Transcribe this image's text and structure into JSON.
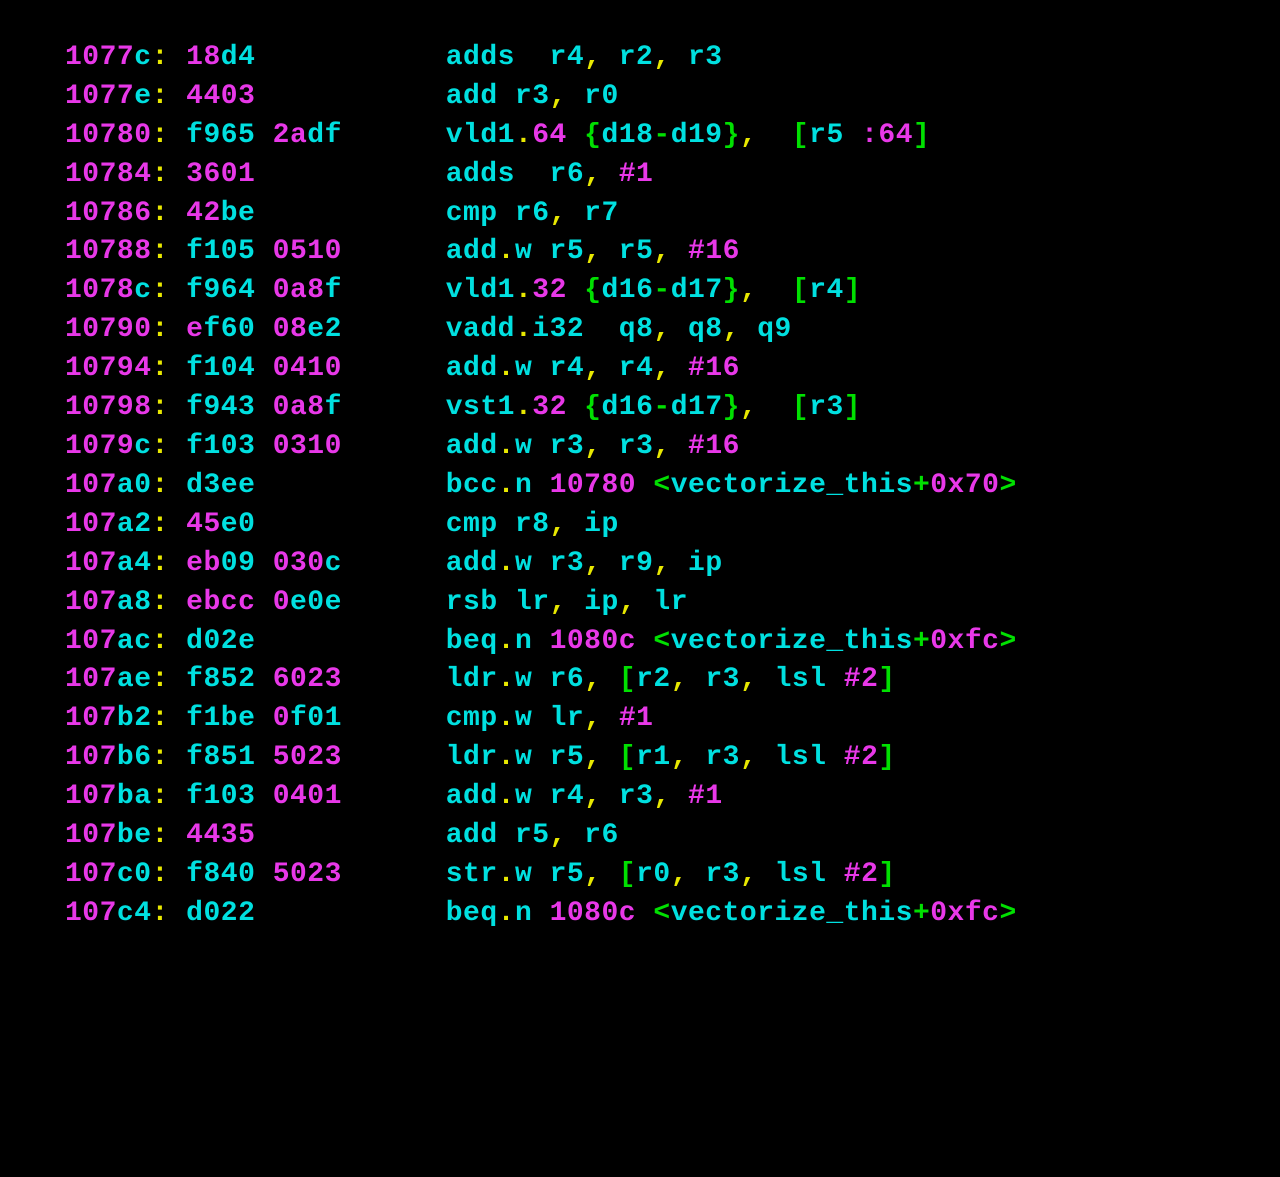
{
  "colors": {
    "bg": "#000000",
    "magenta": "#e838e8",
    "cyan": "#00e0e0",
    "green": "#00e000",
    "yellow": "#e8e800"
  },
  "lines": [
    {
      "addr": [
        "1077",
        "c"
      ],
      "hex": [
        [
          "18",
          "d4"
        ]
      ],
      "body": [
        [
          "c",
          "adds  r4"
        ],
        [
          "y",
          ","
        ],
        [
          "c",
          " r2"
        ],
        [
          "y",
          ","
        ],
        [
          "c",
          " r3"
        ]
      ]
    },
    {
      "addr": [
        "1077",
        "e"
      ],
      "hex": [
        [
          "4403",
          ""
        ]
      ],
      "body": [
        [
          "c",
          "add r3"
        ],
        [
          "y",
          ","
        ],
        [
          "c",
          " r0"
        ]
      ]
    },
    {
      "addr": [
        "10780",
        ""
      ],
      "hex": [
        [
          "",
          "f965"
        ],
        [
          "2a",
          "df"
        ]
      ],
      "body": [
        [
          "c",
          "vld1"
        ],
        [
          "y",
          "."
        ],
        [
          "m",
          "64"
        ],
        [
          "g",
          " {"
        ],
        [
          "c",
          "d18"
        ],
        [
          "g",
          "-"
        ],
        [
          "c",
          "d19"
        ],
        [
          "g",
          "}"
        ],
        [
          "y",
          ","
        ],
        [
          "g",
          "  ["
        ],
        [
          "c",
          "r5 "
        ],
        [
          "m",
          ":64"
        ],
        [
          "g",
          "]"
        ]
      ]
    },
    {
      "addr": [
        "10784",
        ""
      ],
      "hex": [
        [
          "3601",
          ""
        ]
      ],
      "body": [
        [
          "c",
          "adds  r6"
        ],
        [
          "y",
          ","
        ],
        [
          "m",
          " #1"
        ]
      ]
    },
    {
      "addr": [
        "10786",
        ""
      ],
      "hex": [
        [
          "42",
          "be"
        ]
      ],
      "body": [
        [
          "c",
          "cmp r6"
        ],
        [
          "y",
          ","
        ],
        [
          "c",
          " r7"
        ]
      ]
    },
    {
      "addr": [
        "10788",
        ""
      ],
      "hex": [
        [
          "",
          "f105"
        ],
        [
          "0510",
          ""
        ]
      ],
      "body": [
        [
          "c",
          "add"
        ],
        [
          "y",
          "."
        ],
        [
          "c",
          "w r5"
        ],
        [
          "y",
          ","
        ],
        [
          "c",
          " r5"
        ],
        [
          "y",
          ","
        ],
        [
          "m",
          " #16"
        ]
      ]
    },
    {
      "addr": [
        "1078",
        "c"
      ],
      "hex": [
        [
          "",
          "f964"
        ],
        [
          "0a8",
          "f"
        ]
      ],
      "body": [
        [
          "c",
          "vld1"
        ],
        [
          "y",
          "."
        ],
        [
          "m",
          "32"
        ],
        [
          "g",
          " {"
        ],
        [
          "c",
          "d16"
        ],
        [
          "g",
          "-"
        ],
        [
          "c",
          "d17"
        ],
        [
          "g",
          "}"
        ],
        [
          "y",
          ","
        ],
        [
          "g",
          "  ["
        ],
        [
          "c",
          "r4"
        ],
        [
          "g",
          "]"
        ]
      ]
    },
    {
      "addr": [
        "10790",
        ""
      ],
      "hex": [
        [
          "e",
          "f60"
        ],
        [
          "08",
          "e2"
        ]
      ],
      "body": [
        [
          "c",
          "vadd"
        ],
        [
          "y",
          "."
        ],
        [
          "c",
          "i32  q8"
        ],
        [
          "y",
          ","
        ],
        [
          "c",
          " q8"
        ],
        [
          "y",
          ","
        ],
        [
          "c",
          " q9"
        ]
      ]
    },
    {
      "addr": [
        "10794",
        ""
      ],
      "hex": [
        [
          "",
          "f104"
        ],
        [
          "0410",
          ""
        ]
      ],
      "body": [
        [
          "c",
          "add"
        ],
        [
          "y",
          "."
        ],
        [
          "c",
          "w r4"
        ],
        [
          "y",
          ","
        ],
        [
          "c",
          " r4"
        ],
        [
          "y",
          ","
        ],
        [
          "m",
          " #16"
        ]
      ]
    },
    {
      "addr": [
        "10798",
        ""
      ],
      "hex": [
        [
          "",
          "f943"
        ],
        [
          "0a8",
          "f"
        ]
      ],
      "body": [
        [
          "c",
          "vst1"
        ],
        [
          "y",
          "."
        ],
        [
          "m",
          "32"
        ],
        [
          "g",
          " {"
        ],
        [
          "c",
          "d16"
        ],
        [
          "g",
          "-"
        ],
        [
          "c",
          "d17"
        ],
        [
          "g",
          "}"
        ],
        [
          "y",
          ","
        ],
        [
          "g",
          "  ["
        ],
        [
          "c",
          "r3"
        ],
        [
          "g",
          "]"
        ]
      ]
    },
    {
      "addr": [
        "1079",
        "c"
      ],
      "hex": [
        [
          "",
          "f103"
        ],
        [
          "0310",
          ""
        ]
      ],
      "body": [
        [
          "c",
          "add"
        ],
        [
          "y",
          "."
        ],
        [
          "c",
          "w r3"
        ],
        [
          "y",
          ","
        ],
        [
          "c",
          " r3"
        ],
        [
          "y",
          ","
        ],
        [
          "m",
          " #16"
        ]
      ]
    },
    {
      "addr": [
        "107",
        "a0"
      ],
      "hex": [
        [
          "",
          "d3ee"
        ]
      ],
      "body": [
        [
          "c",
          "bcc"
        ],
        [
          "y",
          "."
        ],
        [
          "c",
          "n "
        ],
        [
          "m",
          "10780"
        ],
        [
          "g",
          " <"
        ],
        [
          "c",
          "vectorize_this"
        ],
        [
          "g",
          "+"
        ],
        [
          "m",
          "0x70"
        ],
        [
          "g",
          ">"
        ]
      ]
    },
    {
      "addr": [
        "107",
        "a2"
      ],
      "hex": [
        [
          "45",
          "e0"
        ]
      ],
      "body": [
        [
          "c",
          "cmp r8"
        ],
        [
          "y",
          ","
        ],
        [
          "c",
          " ip"
        ]
      ]
    },
    {
      "addr": [
        "107",
        "a4"
      ],
      "hex": [
        [
          "eb",
          "09"
        ],
        [
          "030",
          "c"
        ]
      ],
      "body": [
        [
          "c",
          "add"
        ],
        [
          "y",
          "."
        ],
        [
          "c",
          "w r3"
        ],
        [
          "y",
          ","
        ],
        [
          "c",
          " r9"
        ],
        [
          "y",
          ","
        ],
        [
          "c",
          " ip"
        ]
      ]
    },
    {
      "addr": [
        "107",
        "a8"
      ],
      "hex": [
        [
          "ebcc",
          ""
        ],
        [
          "0",
          "e0e"
        ]
      ],
      "body": [
        [
          "c",
          "rsb lr"
        ],
        [
          "y",
          ","
        ],
        [
          "c",
          " ip"
        ],
        [
          "y",
          ","
        ],
        [
          "c",
          " lr"
        ]
      ]
    },
    {
      "addr": [
        "107",
        "ac"
      ],
      "hex": [
        [
          "",
          "d02e"
        ]
      ],
      "body": [
        [
          "c",
          "beq"
        ],
        [
          "y",
          "."
        ],
        [
          "c",
          "n "
        ],
        [
          "m",
          "1080c"
        ],
        [
          "g",
          " <"
        ],
        [
          "c",
          "vectorize_this"
        ],
        [
          "g",
          "+"
        ],
        [
          "m",
          "0xfc"
        ],
        [
          "g",
          ">"
        ]
      ]
    },
    {
      "addr": [
        "107",
        "ae"
      ],
      "hex": [
        [
          "",
          "f852"
        ],
        [
          "6023",
          ""
        ]
      ],
      "body": [
        [
          "c",
          "ldr"
        ],
        [
          "y",
          "."
        ],
        [
          "c",
          "w r6"
        ],
        [
          "y",
          ","
        ],
        [
          "g",
          " ["
        ],
        [
          "c",
          "r2"
        ],
        [
          "y",
          ","
        ],
        [
          "c",
          " r3"
        ],
        [
          "y",
          ","
        ],
        [
          "c",
          " lsl "
        ],
        [
          "m",
          "#2"
        ],
        [
          "g",
          "]"
        ]
      ]
    },
    {
      "addr": [
        "107",
        "b2"
      ],
      "hex": [
        [
          "",
          "f1be"
        ],
        [
          "0",
          "f01"
        ]
      ],
      "body": [
        [
          "c",
          "cmp"
        ],
        [
          "y",
          "."
        ],
        [
          "c",
          "w lr"
        ],
        [
          "y",
          ","
        ],
        [
          "m",
          " #1"
        ]
      ]
    },
    {
      "addr": [
        "107",
        "b6"
      ],
      "hex": [
        [
          "",
          "f851"
        ],
        [
          "5023",
          ""
        ]
      ],
      "body": [
        [
          "c",
          "ldr"
        ],
        [
          "y",
          "."
        ],
        [
          "c",
          "w r5"
        ],
        [
          "y",
          ","
        ],
        [
          "g",
          " ["
        ],
        [
          "c",
          "r1"
        ],
        [
          "y",
          ","
        ],
        [
          "c",
          " r3"
        ],
        [
          "y",
          ","
        ],
        [
          "c",
          " lsl "
        ],
        [
          "m",
          "#2"
        ],
        [
          "g",
          "]"
        ]
      ]
    },
    {
      "addr": [
        "107",
        "ba"
      ],
      "hex": [
        [
          "",
          "f103"
        ],
        [
          "0401",
          ""
        ]
      ],
      "body": [
        [
          "c",
          "add"
        ],
        [
          "y",
          "."
        ],
        [
          "c",
          "w r4"
        ],
        [
          "y",
          ","
        ],
        [
          "c",
          " r3"
        ],
        [
          "y",
          ","
        ],
        [
          "m",
          " #1"
        ]
      ]
    },
    {
      "addr": [
        "107",
        "be"
      ],
      "hex": [
        [
          "4435",
          ""
        ]
      ],
      "body": [
        [
          "c",
          "add r5"
        ],
        [
          "y",
          ","
        ],
        [
          "c",
          " r6"
        ]
      ]
    },
    {
      "addr": [
        "107",
        "c0"
      ],
      "hex": [
        [
          "",
          "f840"
        ],
        [
          "5023",
          ""
        ]
      ],
      "body": [
        [
          "c",
          "str"
        ],
        [
          "y",
          "."
        ],
        [
          "c",
          "w r5"
        ],
        [
          "y",
          ","
        ],
        [
          "g",
          " ["
        ],
        [
          "c",
          "r0"
        ],
        [
          "y",
          ","
        ],
        [
          "c",
          " r3"
        ],
        [
          "y",
          ","
        ],
        [
          "c",
          " lsl "
        ],
        [
          "m",
          "#2"
        ],
        [
          "g",
          "]"
        ]
      ]
    },
    {
      "addr": [
        "107",
        "c4"
      ],
      "hex": [
        [
          "",
          "d022"
        ]
      ],
      "body": [
        [
          "c",
          "beq"
        ],
        [
          "y",
          "."
        ],
        [
          "c",
          "n "
        ],
        [
          "m",
          "1080c"
        ],
        [
          "g",
          " <"
        ],
        [
          "c",
          "vectorize_this"
        ],
        [
          "g",
          "+"
        ],
        [
          "m",
          "0xfc"
        ],
        [
          "g",
          ">"
        ]
      ]
    }
  ]
}
